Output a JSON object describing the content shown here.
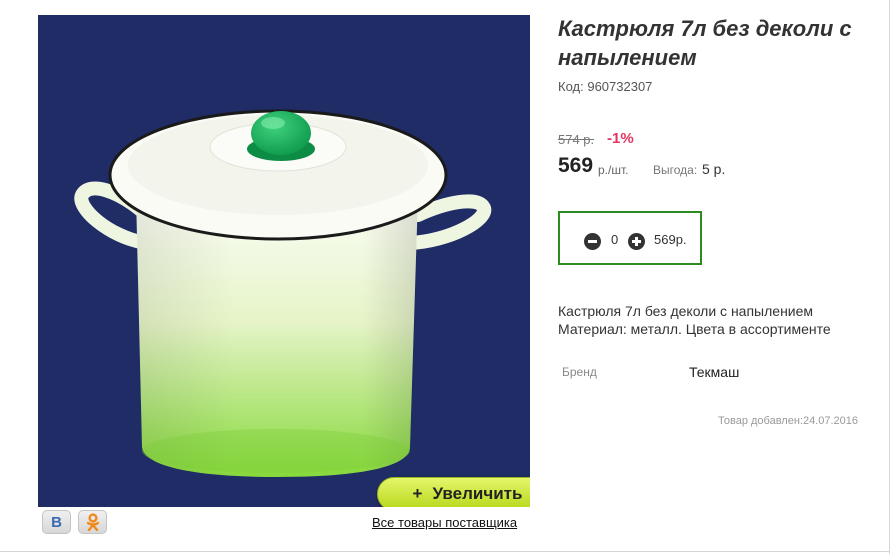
{
  "product": {
    "title": "Кастрюля 7л без деколи с напылением",
    "code_label": "Код:",
    "code_value": "960732307",
    "old_price": "574 р.",
    "discount": "-1%",
    "price": "569",
    "price_unit": "р./шт.",
    "benefit_label": "Выгода:",
    "benefit_value": "5 р.",
    "description_line1": "Кастрюля 7л без деколи с напылением",
    "description_line2": "Материал: металл. Цвета в ассортименте",
    "brand_label": "Бренд",
    "brand_value": "Текмаш",
    "added_text": "Товар добавлен:24.07.2016"
  },
  "cart": {
    "quantity": "0",
    "total": "569р."
  },
  "gallery": {
    "zoom_icon": "+",
    "zoom_label": "Увеличить",
    "supplier_link": "Все товары поставщика"
  },
  "share": {
    "vk_letter": "В",
    "vk_icon": "vk-icon",
    "ok_icon": "odnoklassniki-icon"
  },
  "colors": {
    "photo_background": "#1f2c66",
    "zoom_button": "#c6e331",
    "discount": "#e2365f",
    "qty_border": "#2e8b22"
  }
}
